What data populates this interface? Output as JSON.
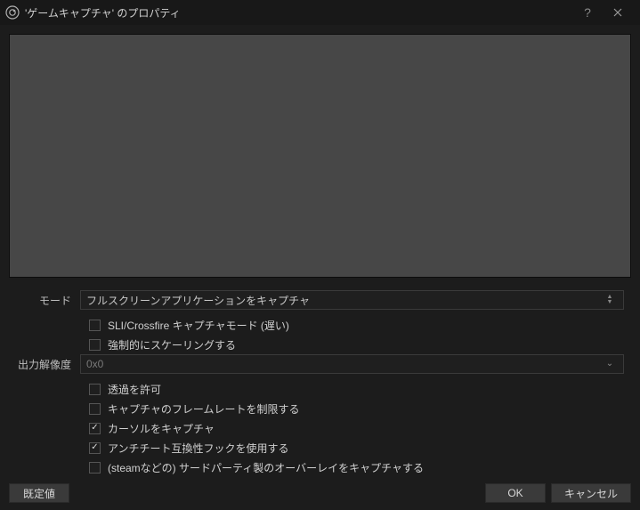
{
  "window": {
    "title": "'ゲームキャプチャ' のプロパティ"
  },
  "form": {
    "mode_label": "モード",
    "mode_value": "フルスクリーンアプリケーションをキャプチャ",
    "sli_label": "SLI/Crossfire キャプチャモード (遅い)",
    "force_scale_label": "強制的にスケーリングする",
    "resolution_label": "出力解像度",
    "resolution_value": "0x0",
    "allow_transparency_label": "透過を許可",
    "limit_framerate_label": "キャプチャのフレームレートを制限する",
    "capture_cursor_label": "カーソルをキャプチャ",
    "anticheat_hook_label": "アンチチート互換性フックを使用する",
    "capture_overlays_label": "(steamなどの) サードパーティ製のオーバーレイをキャプチャする"
  },
  "buttons": {
    "defaults": "既定値",
    "ok": "OK",
    "cancel": "キャンセル"
  }
}
